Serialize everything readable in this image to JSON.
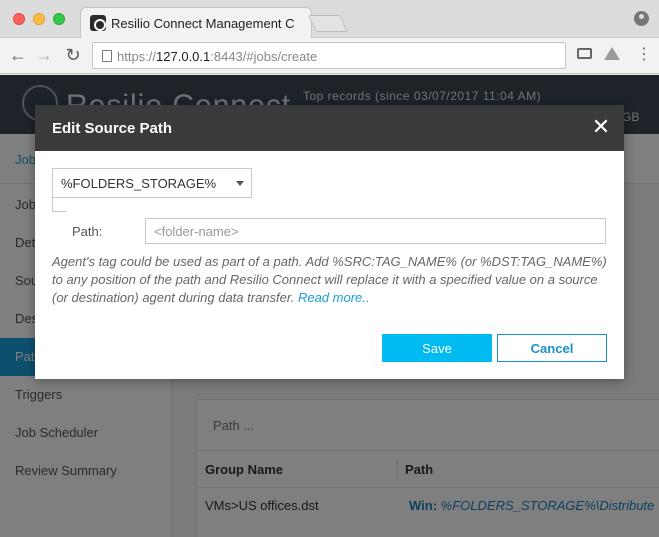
{
  "browser": {
    "tab_title": "Resilio Connect Management C",
    "url_scheme": "https://",
    "url_host": "127.0.0.1",
    "url_rest": ":8443/#jobs/create"
  },
  "app": {
    "logo_text": "Resilio Connect",
    "top_records": "Top records (since  03/07/2017 11:04 AM)",
    "storage_suffix": "GB",
    "breadcrumb": "Job",
    "sidebar": {
      "items": [
        {
          "label": "Job"
        },
        {
          "label": "Det"
        },
        {
          "label": "Sou"
        },
        {
          "label": "Des"
        },
        {
          "label": "Path"
        },
        {
          "label": "Triggers"
        },
        {
          "label": "Job Scheduler"
        },
        {
          "label": "Review Summary"
        }
      ]
    },
    "panel": {
      "title": "Path ...",
      "columns": [
        "Group Name",
        "Path"
      ],
      "rows": [
        {
          "group": "VMs>US offices.dst",
          "path_prefix": "Win:",
          "path_value": "%FOLDERS_STORAGE%\\Distribute VMs"
        }
      ]
    }
  },
  "modal": {
    "title": "Edit Source Path",
    "close_glyph": "✕",
    "tag_select_value": "%FOLDERS_STORAGE%",
    "path_label": "Path:",
    "path_value": "",
    "path_placeholder": "<folder-name>",
    "help_text": "Agent's tag could be used as part of a path. Add %SRC:TAG_NAME% (or %DST:TAG_NAME%) to any position of the path and Resilio Connect will replace it with a specified value on a source (or destination) agent during data transfer. ",
    "read_more": "Read more..",
    "save_label": "Save",
    "cancel_label": "Cancel"
  },
  "colors": {
    "accent": "#00bbf2",
    "header": "#3a3a3a",
    "link": "#1a9fd8"
  }
}
